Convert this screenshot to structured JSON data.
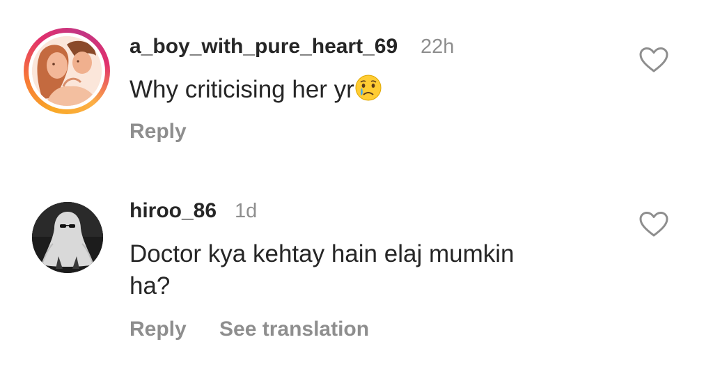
{
  "comments": [
    {
      "username": "a_boy_with_pure_heart_69",
      "time": "22h",
      "text": "Why criticising her yr",
      "emoji": "crying-face",
      "actions": [
        "Reply"
      ],
      "avatar_icon": "couple-portrait",
      "has_story_ring": true
    },
    {
      "username": "hiroo_86",
      "time": "1d",
      "text_line1": "Doctor kya kehtay hain elaj mumkin",
      "text_line2": "ha?",
      "actions": [
        "Reply",
        "See translation"
      ],
      "avatar_icon": "ghost-portrait",
      "has_story_ring": false
    }
  ],
  "colors": {
    "text_primary": "#262626",
    "text_secondary": "#8e8e8e",
    "story_ring": [
      "#f9a826",
      "#e1306c",
      "#c13584"
    ]
  },
  "icons": [
    "heart-outline-icon",
    "crying-face-emoji"
  ]
}
